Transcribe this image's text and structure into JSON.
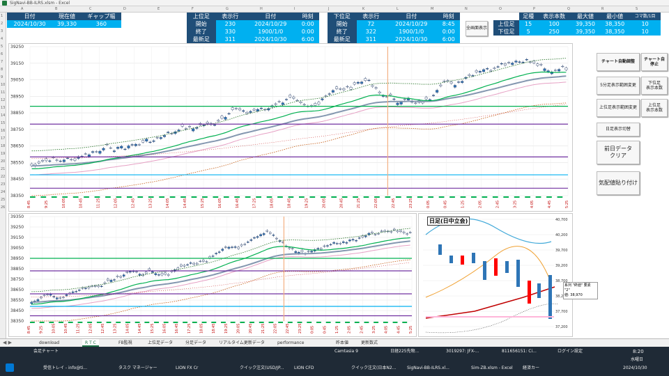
{
  "window": {
    "title": "SigNavi-BB-ILRS.xlsm - Excel"
  },
  "columns": [
    "A",
    "B",
    "C",
    "D",
    "E",
    "F",
    "G",
    "H",
    "I",
    "J",
    "K",
    "L",
    "M",
    "N",
    "O",
    "P",
    "Q",
    "R",
    "S"
  ],
  "rows": [
    "1",
    "2",
    "3",
    "4",
    "5",
    "6",
    "7",
    "8",
    "9",
    "10",
    "11",
    "12",
    "13",
    "14",
    "15",
    "16",
    "17",
    "18",
    "19",
    "20",
    "21",
    "22",
    "23",
    "24",
    "25",
    "26"
  ],
  "summary": {
    "h_date": "日付",
    "h_price": "現在値",
    "h_gap": "ギャップ幅",
    "date": "2024/10/30",
    "price": "39,330",
    "gap": "360"
  },
  "upper_table": {
    "title": "上位足",
    "h_rows": "表示行",
    "h_date": "日付",
    "h_time": "時刻",
    "rows": [
      {
        "label": "開始",
        "n": "230",
        "date": "2024/10/29",
        "time": "0:00"
      },
      {
        "label": "終了",
        "n": "330",
        "date": "1900/1/0",
        "time": "0:00"
      },
      {
        "label": "最新足",
        "n": "311",
        "date": "2024/10/30",
        "time": "6:00"
      }
    ]
  },
  "lower_table": {
    "title": "下位足",
    "h_rows": "表示行",
    "h_date": "日付",
    "h_time": "時刻",
    "rows": [
      {
        "label": "開始",
        "n": "72",
        "date": "2024/10/29",
        "time": "8:45"
      },
      {
        "label": "終了",
        "n": "322",
        "date": "1900/1/0",
        "time": "0:00"
      },
      {
        "label": "最新足",
        "n": "311",
        "date": "2024/10/30",
        "time": "6:00"
      }
    ]
  },
  "full_display_button": "全画面表示",
  "bar_table": {
    "h_kind": "足種",
    "h_count": "表示本数",
    "h_max": "最大値",
    "h_min": "最小値",
    "h_koma": "コマ数/1目",
    "rows": [
      {
        "label": "上位足",
        "kind": "15",
        "count": "100",
        "max": "39,350",
        "min": "38,350",
        "koma": "10"
      },
      {
        "label": "下位足",
        "kind": "5",
        "count": "250",
        "max": "39,350",
        "min": "38,350",
        "koma": "10"
      }
    ]
  },
  "buttons": {
    "auto": "チャート自動調整",
    "auto2": "チャート自\n停止",
    "upper_range": "5分足表示範囲変更",
    "upper_scale": "下位足\n表示本数",
    "lower_range": "上位足表示範囲変更",
    "lower_scale": "上位足\n表示本数",
    "daily": "日足表示切替",
    "prev": "前日データ\nクリア",
    "kehai": "気配値貼り付け"
  },
  "chart_top": {
    "yticks": [
      "39250",
      "39150",
      "39050",
      "38950",
      "38850",
      "38750",
      "38650",
      "38550",
      "38450",
      "38350"
    ],
    "xticks": [
      "8:45",
      "9:25",
      "10:05",
      "10:45",
      "11:25",
      "12:05",
      "12:45",
      "13:25",
      "14:05",
      "14:45",
      "15:25",
      "16:05",
      "16:45",
      "17:25",
      "18:05",
      "18:45",
      "19:25",
      "20:05",
      "20:45",
      "21:25",
      "22:05",
      "22:45",
      "23:25",
      "0:05",
      "0:45",
      "1:25",
      "2:05",
      "2:45",
      "3:25",
      "4:05",
      "4:45",
      "5:25"
    ]
  },
  "chart_bottom": {
    "yticks": [
      "39350",
      "39250",
      "39150",
      "39050",
      "38950",
      "38850",
      "38750",
      "38650",
      "38550",
      "38450",
      "38350"
    ],
    "xticks": [
      "8:45",
      "9:25",
      "10:05",
      "10:45",
      "11:25",
      "12:05",
      "12:45",
      "13:25",
      "14:05",
      "14:45",
      "15:25",
      "16:05",
      "16:45",
      "17:25",
      "18:05",
      "18:45",
      "19:25",
      "20:05",
      "20:45",
      "21:25",
      "22:05",
      "22:45",
      "23:25",
      "0:05",
      "0:45",
      "1:25",
      "2:05",
      "2:45",
      "3:25",
      "4:05",
      "4:45",
      "5:25"
    ]
  },
  "chart_daily": {
    "title": "日足(日中立会)",
    "yticks": [
      "40,700",
      "40,200",
      "39,700",
      "39,200",
      "38,700",
      "38,200",
      "37,700",
      "37,200"
    ],
    "tooltip": "系列 \"終値\" 要素 \"2\"\n値: 38,970"
  },
  "sheet_tabs": [
    "download",
    "R T C",
    "FB監視",
    "上位足データ",
    "分足データ",
    "リアルタイム更新データ",
    "performance",
    "昨本値",
    "更新数式"
  ],
  "active_tab": "R T C",
  "taskbar": {
    "items": [
      "会足チャート",
      "受信トレイ - info@ti...",
      "タスク マネージャー",
      "LION FX Cr",
      "クイック注文(USD/JP...",
      "LION CFD",
      "クイック注文(日本N2...",
      "SigNavi-BB-ILRS.xl...",
      "Sim-ZB.xlsm - Excel",
      "経済カー"
    ],
    "top_items": [
      "Camtasia 9",
      "日経225先物...",
      "3019297: JFX-...",
      "811656151: Ci...",
      "ログイン設定"
    ],
    "time": "8:20",
    "day": "水曜日",
    "date": "2024/10/30"
  }
}
